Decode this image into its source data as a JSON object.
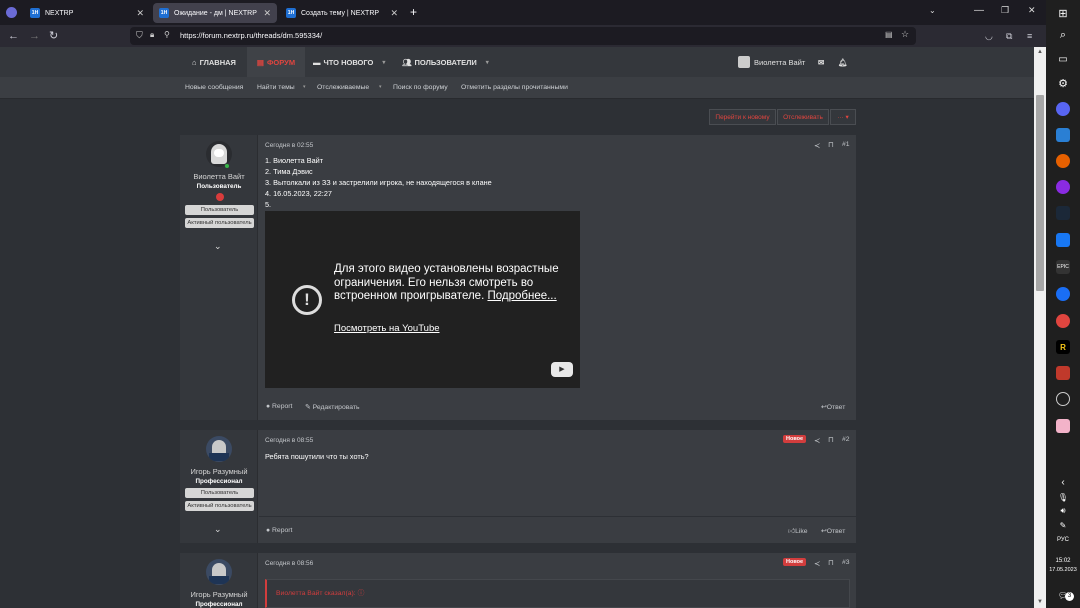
{
  "browser": {
    "tabs": [
      {
        "label": "NEXTRP",
        "favicon": "1H"
      },
      {
        "label": "Ожидание - дм | NEXTRP",
        "favicon": "1H"
      },
      {
        "label": "Создать тему | NEXTRP",
        "favicon": "1H"
      }
    ],
    "new_tab": "+",
    "url": "https://forum.nextrp.ru/threads/dm.595334/"
  },
  "site": {
    "nav": [
      "ГЛАВНАЯ",
      "ФОРУМ",
      "ЧТО НОВОГО",
      "ПОЛЬЗОВАТЕЛИ"
    ],
    "user": "Виолетта Вайт",
    "subnav": [
      "Новые сообщения",
      "Найти темы",
      "Отслеживаемые",
      "Поиск по форуму",
      "Отметить разделы прочитанными"
    ],
    "actions": {
      "jump": "Перейти к новому",
      "watch": "Отслеживать",
      "more": "··· ▾"
    }
  },
  "posts": [
    {
      "author": "Виолетта Вайт",
      "title": "Пользователь",
      "banner1": "Пользователь",
      "banner2": "Активный пользователь",
      "time": "Сегодня в 02:55",
      "num": "#1",
      "lines": [
        "1. Виолетта Вайт",
        "2. Тима Дэвис",
        "3. Вытолкали из ЗЗ и застрелили игрока, не находящегося в клане",
        "4. 16.05.2023, 22:27",
        "5."
      ],
      "video": {
        "msg": "Для этого видео установлены возрастные ограничения. Его нельзя смотреть во встроенном проигрывателе.",
        "more": "Подробнее...",
        "link": "Посмотреть на YouTube"
      },
      "report": "Report",
      "edit": "Редактировать",
      "reply": "Ответ"
    },
    {
      "author": "Игорь Разумный",
      "title": "Профессионал",
      "banner1": "Пользователь",
      "banner2": "Активный пользователь",
      "time": "Сегодня в 08:55",
      "num": "#2",
      "badge": "Новое",
      "text": "Ребята пошутили что ты хоть?",
      "report": "Report",
      "like": "Like",
      "reply": "Ответ"
    },
    {
      "author": "Игорь Разумный",
      "title": "Профессионал",
      "time": "Сегодня в 08:56",
      "num": "#3",
      "badge": "Новое",
      "quote": "Виолетта Вайт сказал(а): ⓘ"
    }
  ],
  "taskbar": {
    "lang": "РУС",
    "time": "15:02",
    "date": "17.05.2023",
    "notif": "3"
  }
}
